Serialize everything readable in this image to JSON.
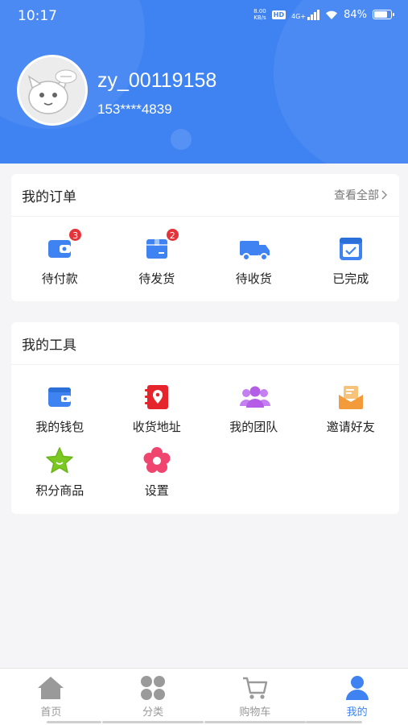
{
  "status_bar": {
    "time": "10:17",
    "net_speed_value": "8.00",
    "net_speed_unit": "KB/s",
    "hd": "HD",
    "network": "4G+",
    "battery": "84%",
    "battery_level": 0.84
  },
  "profile": {
    "username": "zy_00119158",
    "phone": "153****4839"
  },
  "orders": {
    "title": "我的订单",
    "view_all": "查看全部",
    "items": [
      {
        "label": "待付款",
        "badge": "3",
        "icon": "wallet-icon"
      },
      {
        "label": "待发货",
        "badge": "2",
        "icon": "package-box-icon"
      },
      {
        "label": "待收货",
        "badge": "",
        "icon": "delivery-truck-icon"
      },
      {
        "label": "已完成",
        "badge": "",
        "icon": "checked-calendar-icon"
      }
    ]
  },
  "tools": {
    "title": "我的工具",
    "items": [
      {
        "label": "我的钱包",
        "icon": "wallet-icon"
      },
      {
        "label": "收货地址",
        "icon": "address-book-icon"
      },
      {
        "label": "我的团队",
        "icon": "team-icon"
      },
      {
        "label": "邀请好友",
        "icon": "envelope-icon"
      },
      {
        "label": "积分商品",
        "icon": "star-icon"
      },
      {
        "label": "设置",
        "icon": "settings-flower-icon"
      }
    ]
  },
  "tabbar": {
    "items": [
      {
        "label": "首页",
        "icon": "home-icon",
        "active": false
      },
      {
        "label": "分类",
        "icon": "category-grid-icon",
        "active": false
      },
      {
        "label": "购物车",
        "icon": "cart-icon",
        "active": false
      },
      {
        "label": "我的",
        "icon": "user-icon",
        "active": true
      }
    ]
  },
  "colors": {
    "primary": "#3f83f2",
    "badge": "#e5333a",
    "wallet": "#3f83f2",
    "address": "#e5242c",
    "team": "#b45de6",
    "invite": "#f39b3a",
    "star": "#7cc823",
    "settings": "#f0456e"
  }
}
